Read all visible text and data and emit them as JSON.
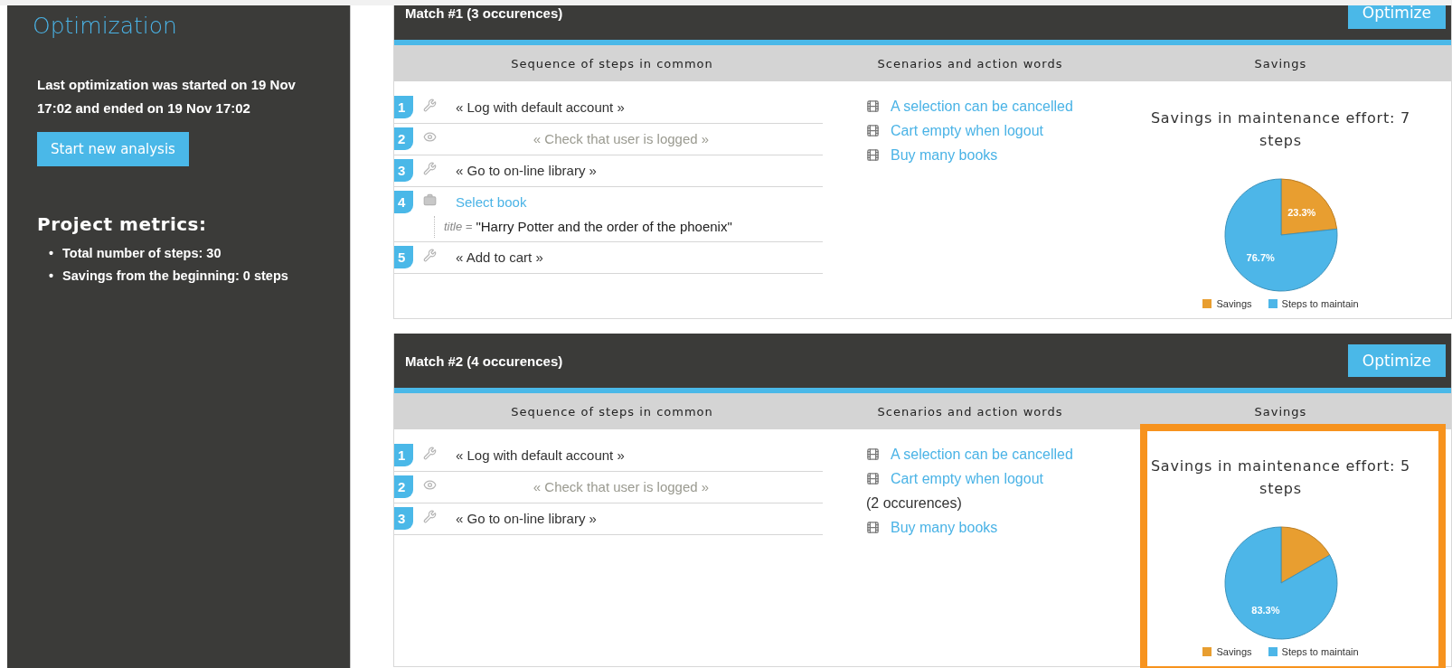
{
  "sidebar": {
    "title": "Optimization",
    "summary": "Last optimization was started on 19 Nov 17:02 and ended on 19 Nov 17:02",
    "button": "Start new analysis",
    "metrics_title": "Project metrics:",
    "metrics": [
      {
        "bullet": "•",
        "text": "Total number of steps: 30"
      },
      {
        "bullet": "•",
        "text": "Savings from the beginning: 0 steps"
      }
    ]
  },
  "matches": [
    {
      "title": "Match #1 (3 occurences)",
      "button": "Optimize",
      "highlighted": false,
      "columns": [
        "Sequence of steps in common",
        "Scenarios and action words",
        "Savings"
      ],
      "steps": [
        {
          "number": "1",
          "kind": "call",
          "text": "« Log with default account »"
        },
        {
          "number": "2",
          "kind": "check",
          "text": "« Check that user is logged »"
        },
        {
          "number": "3",
          "kind": "call",
          "text": "« Go to on-line library »"
        },
        {
          "number": "4",
          "kind": "action",
          "text": "Select book",
          "param": {
            "label": "title =",
            "value": "\"Harry Potter and the order of the phoenix\""
          }
        },
        {
          "number": "5",
          "kind": "call",
          "text": "« Add to cart »"
        }
      ],
      "scenarios": [
        {
          "text": "A selection can be cancelled"
        },
        {
          "text": "Cart empty when logout"
        },
        {
          "text": "Buy many books"
        }
      ],
      "chart_data": {
        "type": "pie",
        "title": "Savings in maintenance effort: 7 steps",
        "categories": [
          "Savings",
          "Steps to maintain"
        ],
        "values": [
          23.3,
          76.7
        ],
        "colors": [
          "#e89e30",
          "#4db6e8"
        ],
        "value_labels": [
          "23.3%",
          "76.7%"
        ],
        "legend": "bottom"
      }
    },
    {
      "title": "Match #2 (4 occurences)",
      "button": "Optimize",
      "highlighted": true,
      "columns": [
        "Sequence of steps in common",
        "Scenarios and action words",
        "Savings"
      ],
      "steps": [
        {
          "number": "1",
          "kind": "call",
          "text": "« Log with default account »"
        },
        {
          "number": "2",
          "kind": "check",
          "text": "« Check that user is logged »"
        },
        {
          "number": "3",
          "kind": "call",
          "text": "« Go to on-line library »"
        }
      ],
      "scenarios": [
        {
          "text": "A selection can be cancelled"
        },
        {
          "text": "Cart empty when logout",
          "note": "(2 occurences)"
        },
        {
          "text": "Buy many books"
        }
      ],
      "chart_data": {
        "type": "pie",
        "title": "Savings in maintenance effort: 5 steps",
        "categories": [
          "Savings",
          "Steps to maintain"
        ],
        "values": [
          16.7,
          83.3
        ],
        "colors": [
          "#e89e30",
          "#4db6e8"
        ],
        "value_labels": [
          null,
          "83.3%"
        ],
        "legend": "bottom"
      }
    }
  ]
}
